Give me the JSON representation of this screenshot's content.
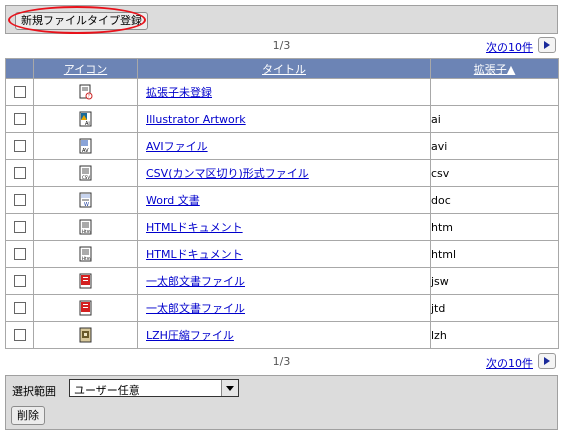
{
  "toolbar": {
    "new_filetype_label": "新規ファイルタイプ登録"
  },
  "pager": {
    "page": "1/3",
    "next_label": "次の10件"
  },
  "table": {
    "headers": {
      "icon": "アイコン",
      "title": "タイトル",
      "ext": "拡張子▲"
    },
    "rows": [
      {
        "icon": "unregistered-ext-icon",
        "title": "拡張子未登録",
        "ext": ""
      },
      {
        "icon": "illustrator-file-icon",
        "title": "Illustrator Artwork",
        "ext": "ai"
      },
      {
        "icon": "avi-file-icon",
        "title": "AVIファイル",
        "ext": "avi"
      },
      {
        "icon": "csv-file-icon",
        "title": "CSV(カンマ区切り)形式ファイル",
        "ext": "csv"
      },
      {
        "icon": "word-document-icon",
        "title": "Word 文書",
        "ext": "doc"
      },
      {
        "icon": "html-document-icon",
        "title": "HTMLドキュメント",
        "ext": "htm"
      },
      {
        "icon": "html-document-icon",
        "title": "HTMLドキュメント",
        "ext": "html"
      },
      {
        "icon": "ichitaro-file-icon",
        "title": "一太郎文書ファイル",
        "ext": "jsw"
      },
      {
        "icon": "ichitaro-file-icon",
        "title": "一太郎文書ファイル",
        "ext": "jtd"
      },
      {
        "icon": "lzh-archive-icon",
        "title": "LZH圧縮ファイル",
        "ext": "lzh"
      }
    ]
  },
  "footer": {
    "range_label": "選択範囲",
    "range_value": "ユーザー任意",
    "delete_label": "削除"
  },
  "colors": {
    "header_bg": "#6c84b5",
    "link": "#0000cc",
    "panel_bg": "#dcdcdc",
    "highlight": "#e8121b"
  }
}
